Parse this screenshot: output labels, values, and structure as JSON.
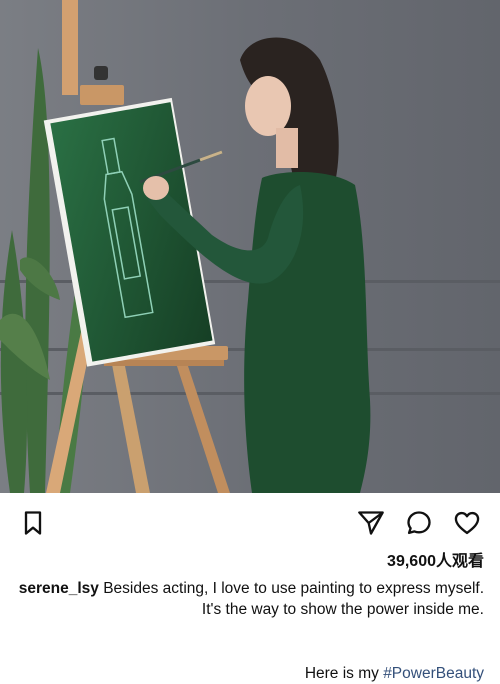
{
  "post": {
    "views_text": "39,600人观看",
    "caption_username": "serene_lsy",
    "caption_part1": "Besides acting, I love to use painting to express myself.",
    "caption_part2": "It's the way to show the power inside me.",
    "hashtag_prefix": "Here is my ",
    "hashtag": "#PowerBeauty"
  },
  "icons": {
    "bookmark": "bookmark-icon",
    "share": "send-icon",
    "comment": "comment-icon",
    "like": "heart-icon"
  },
  "colors": {
    "background": "#ffffff",
    "text": "#111111",
    "hashtag": "#34507a",
    "dress": "#1e4d2f",
    "canvas": "#1f5a34"
  }
}
